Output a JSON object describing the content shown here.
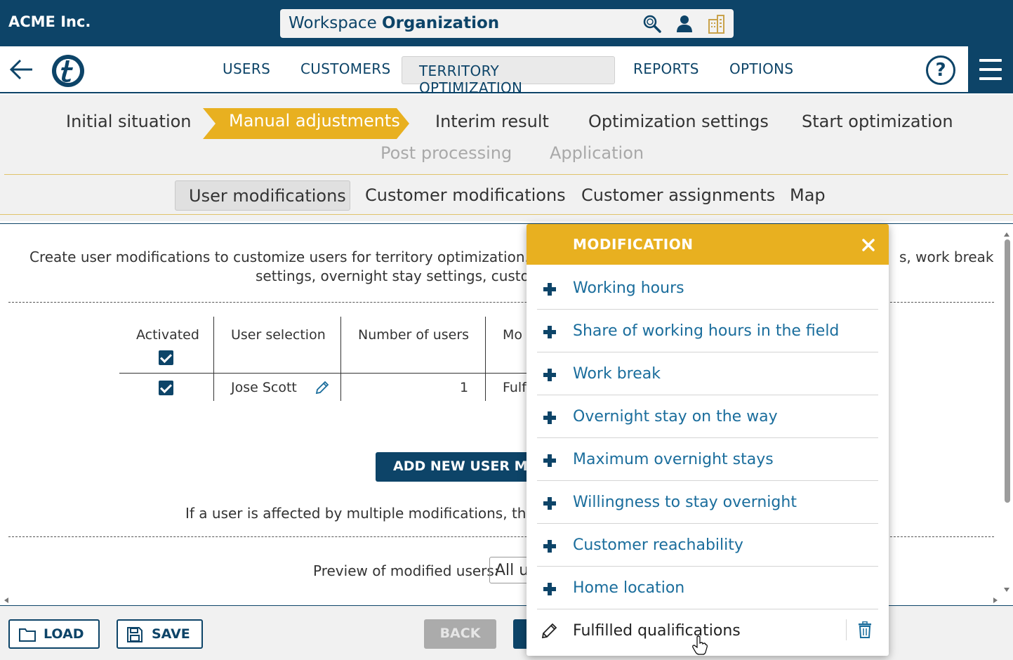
{
  "colors": {
    "primary": "#0d4468",
    "accent": "#e8b020",
    "link": "#1a6d9c",
    "background_light": "#f1f1f1"
  },
  "topbar": {
    "brand": "ACME Inc.",
    "workspace_prefix": "Workspace",
    "workspace_name": "Organization",
    "icons": [
      "search-icon",
      "user-icon",
      "building-icon"
    ]
  },
  "nav": {
    "items": [
      {
        "label": "USERS",
        "active": false
      },
      {
        "label": "CUSTOMERS",
        "active": false
      },
      {
        "label": "TERRITORY OPTIMIZATION",
        "active": true
      },
      {
        "label": "REPORTS",
        "active": false
      },
      {
        "label": "OPTIONS",
        "active": false
      }
    ],
    "help_label": "?"
  },
  "steps": {
    "row1": [
      {
        "label": "Initial situation",
        "state": "normal"
      },
      {
        "label": "Manual adjustments",
        "state": "active"
      },
      {
        "label": "Interim result",
        "state": "normal"
      },
      {
        "label": "Optimization settings",
        "state": "normal"
      },
      {
        "label": "Start optimization",
        "state": "normal"
      }
    ],
    "row2": [
      {
        "label": "Post processing",
        "state": "disabled"
      },
      {
        "label": "Application",
        "state": "disabled"
      }
    ]
  },
  "subtabs": [
    {
      "label": "User modifications",
      "active": true
    },
    {
      "label": "Customer modifications",
      "active": false
    },
    {
      "label": "Customer assignments",
      "active": false
    },
    {
      "label": "Map",
      "active": false
    }
  ],
  "content": {
    "description_line1_left": "Create user modifications to customize users for territory optimization. You",
    "description_line1_right": "s, work break",
    "description_line2": "settings, overnight stay settings, custome",
    "table": {
      "headers": [
        "Activated",
        "User selection",
        "Number of users",
        "Mo"
      ],
      "rows": [
        {
          "activated": true,
          "user": "Jose Scott",
          "count": "1",
          "mod": "Fulf"
        }
      ]
    },
    "add_button": "ADD NEW USER MO",
    "info_text": "If a user is affected by multiple modifications, the mo",
    "preview_label": "Preview of modified users:",
    "preview_value": "All u"
  },
  "footer": {
    "load": "LOAD",
    "save": "SAVE",
    "back": "BACK"
  },
  "modal": {
    "title": "MODIFICATION",
    "items": [
      {
        "label": "Working hours",
        "icon": "plus-icon"
      },
      {
        "label": "Share of working hours in the field",
        "icon": "plus-icon"
      },
      {
        "label": "Work break",
        "icon": "plus-icon"
      },
      {
        "label": "Overnight stay on the way",
        "icon": "plus-icon"
      },
      {
        "label": "Maximum overnight stays",
        "icon": "plus-icon"
      },
      {
        "label": "Willingness to stay overnight",
        "icon": "plus-icon"
      },
      {
        "label": "Customer reachability",
        "icon": "plus-icon"
      },
      {
        "label": "Home location",
        "icon": "plus-icon"
      },
      {
        "label": "Fulfilled qualifications",
        "icon": "pencil-icon"
      }
    ]
  }
}
